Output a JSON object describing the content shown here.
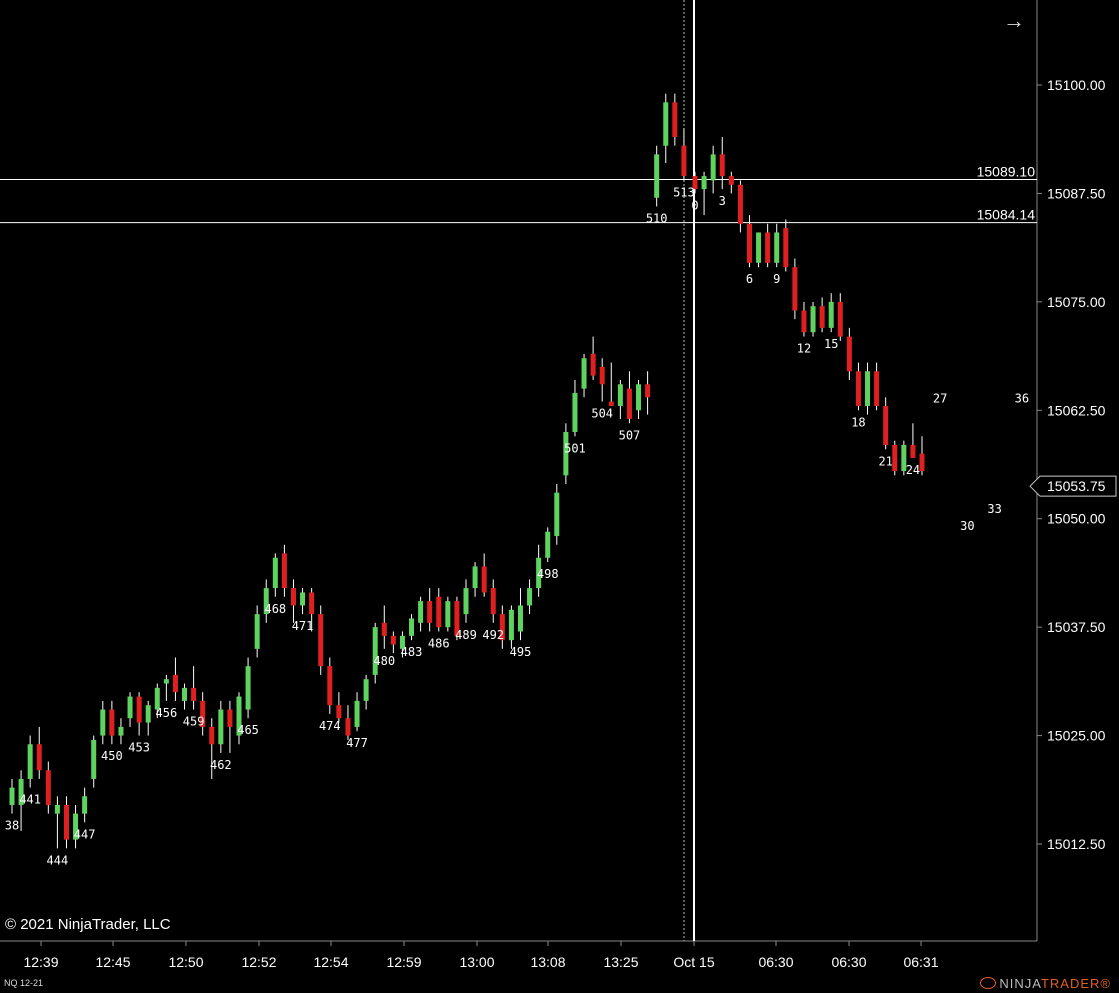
{
  "instrument": "NQ 12-21",
  "copyright": "© 2021 NinjaTrader, LLC",
  "brand": {
    "left": "NINJA",
    "right": "TRADER",
    "mark": "®"
  },
  "nav_arrow": "→",
  "colors": {
    "background": "#000000",
    "up": "#5fd35f",
    "down": "#e02020",
    "wick": "#ffffff",
    "axis_text": "#ffffff"
  },
  "price_axis": {
    "ticks": [
      "15100.00",
      "15087.50",
      "15075.00",
      "15062.50",
      "15050.00",
      "15037.50",
      "15025.00",
      "15012.50"
    ],
    "tick_values": [
      15100,
      15087.5,
      15075,
      15062.5,
      15050,
      15037.5,
      15025,
      15012.5
    ],
    "last_price": "15053.75"
  },
  "time_axis": {
    "labels": [
      "12:39",
      "12:45",
      "12:50",
      "12:52",
      "12:54",
      "12:59",
      "13:00",
      "13:08",
      "13:25",
      "Oct 15",
      "06:30",
      "06:30",
      "06:31"
    ]
  },
  "horizontal_lines": [
    {
      "label": "15089.10",
      "price": 15089.1
    },
    {
      "label": "15084.14",
      "price": 15084.14
    }
  ],
  "chart_data": {
    "type": "candlestick",
    "ylim": [
      15002,
      15110
    ],
    "session_break_index": 38,
    "candles": [
      {
        "o": 15017.0,
        "h": 15020.0,
        "l": 15016.0,
        "c": 15019.0
      },
      {
        "o": 15017.0,
        "h": 15021.0,
        "l": 15014.0,
        "c": 15020.0
      },
      {
        "o": 15020.0,
        "h": 15025.0,
        "l": 15019.0,
        "c": 15024.0
      },
      {
        "o": 15024.0,
        "h": 15026.0,
        "l": 15020.0,
        "c": 15021.0
      },
      {
        "o": 15021.0,
        "h": 15022.0,
        "l": 15016.0,
        "c": 15017.0
      },
      {
        "o": 15016.0,
        "h": 15018.0,
        "l": 15012.0,
        "c": 15017.0
      },
      {
        "o": 15017.0,
        "h": 15018.0,
        "l": 15012.0,
        "c": 15013.0
      },
      {
        "o": 15013.0,
        "h": 15017.0,
        "l": 15012.0,
        "c": 15016.0
      },
      {
        "o": 15016.0,
        "h": 15019.0,
        "l": 15015.0,
        "c": 15018.0
      },
      {
        "o": 15020.0,
        "h": 15025.0,
        "l": 15019.0,
        "c": 15024.5
      },
      {
        "o": 15025.0,
        "h": 15029.0,
        "l": 15024.0,
        "c": 15028.0
      },
      {
        "o": 15028.0,
        "h": 15029.0,
        "l": 15024.0,
        "c": 15025.0
      },
      {
        "o": 15025.0,
        "h": 15027.0,
        "l": 15024.0,
        "c": 15026.0
      },
      {
        "o": 15027.0,
        "h": 15030.0,
        "l": 15026.0,
        "c": 15029.5
      },
      {
        "o": 15029.5,
        "h": 15030.0,
        "l": 15025.0,
        "c": 15026.5
      },
      {
        "o": 15026.5,
        "h": 15029.0,
        "l": 15025.0,
        "c": 15028.5
      },
      {
        "o": 15028.0,
        "h": 15031.0,
        "l": 15027.0,
        "c": 15030.5
      },
      {
        "o": 15031.0,
        "h": 15032.0,
        "l": 15029.0,
        "c": 15031.5
      },
      {
        "o": 15032.0,
        "h": 15034.0,
        "l": 15029.0,
        "c": 15030.0
      },
      {
        "o": 15029.0,
        "h": 15031.0,
        "l": 15028.0,
        "c": 15030.5
      },
      {
        "o": 15030.5,
        "h": 15033.0,
        "l": 15028.0,
        "c": 15029.0
      },
      {
        "o": 15029.0,
        "h": 15030.0,
        "l": 15025.0,
        "c": 15026.0
      },
      {
        "o": 15026.0,
        "h": 15027.0,
        "l": 15020.0,
        "c": 15024.0
      },
      {
        "o": 15024.0,
        "h": 15029.0,
        "l": 15023.0,
        "c": 15028.0
      },
      {
        "o": 15028.0,
        "h": 15029.0,
        "l": 15023.0,
        "c": 15026.0
      },
      {
        "o": 15025.0,
        "h": 15030.0,
        "l": 15024.0,
        "c": 15029.5
      },
      {
        "o": 15028.0,
        "h": 15034.0,
        "l": 15027.0,
        "c": 15033.0
      },
      {
        "o": 15035.0,
        "h": 15040.0,
        "l": 15034.0,
        "c": 15039.0
      },
      {
        "o": 15039.0,
        "h": 15043.0,
        "l": 15038.0,
        "c": 15042.0
      },
      {
        "o": 15042.0,
        "h": 15046.0,
        "l": 15041.0,
        "c": 15045.5
      },
      {
        "o": 15046.0,
        "h": 15047.0,
        "l": 15041.0,
        "c": 15042.0
      },
      {
        "o": 15042.0,
        "h": 15043.0,
        "l": 15038.0,
        "c": 15040.0
      },
      {
        "o": 15040.0,
        "h": 15042.0,
        "l": 15039.0,
        "c": 15041.5
      },
      {
        "o": 15041.5,
        "h": 15042.0,
        "l": 15037.0,
        "c": 15039.0
      },
      {
        "o": 15039.0,
        "h": 15040.0,
        "l": 15032.0,
        "c": 15033.0
      },
      {
        "o": 15033.0,
        "h": 15034.0,
        "l": 15027.5,
        "c": 15028.5
      },
      {
        "o": 15028.5,
        "h": 15030.0,
        "l": 15026.5,
        "c": 15027.0
      },
      {
        "o": 15027.0,
        "h": 15028.5,
        "l": 15024.5,
        "c": 15025.0
      },
      {
        "o": 15026.0,
        "h": 15030.0,
        "l": 15025.5,
        "c": 15029.0
      },
      {
        "o": 15029.0,
        "h": 15032.0,
        "l": 15028.0,
        "c": 15031.5
      },
      {
        "o": 15032.0,
        "h": 15038.0,
        "l": 15031.0,
        "c": 15037.5
      },
      {
        "o": 15038.0,
        "h": 15040.0,
        "l": 15035.0,
        "c": 15036.5
      },
      {
        "o": 15036.5,
        "h": 15037.0,
        "l": 15034.5,
        "c": 15035.5
      },
      {
        "o": 15035.0,
        "h": 15037.0,
        "l": 15034.0,
        "c": 15036.5
      },
      {
        "o": 15036.5,
        "h": 15039.0,
        "l": 15036.0,
        "c": 15038.5
      },
      {
        "o": 15038.0,
        "h": 15041.0,
        "l": 15037.0,
        "c": 15040.5
      },
      {
        "o": 15040.5,
        "h": 15042.0,
        "l": 15037.0,
        "c": 15038.0
      },
      {
        "o": 15041.0,
        "h": 15042.0,
        "l": 15037.0,
        "c": 15037.5
      },
      {
        "o": 15037.5,
        "h": 15041.0,
        "l": 15037.0,
        "c": 15040.5
      },
      {
        "o": 15040.5,
        "h": 15041.0,
        "l": 15036.0,
        "c": 15036.5
      },
      {
        "o": 15039.0,
        "h": 15043.0,
        "l": 15038.0,
        "c": 15042.0
      },
      {
        "o": 15042.0,
        "h": 15045.0,
        "l": 15041.0,
        "c": 15044.5
      },
      {
        "o": 15044.5,
        "h": 15046.0,
        "l": 15041.0,
        "c": 15041.5
      },
      {
        "o": 15042.0,
        "h": 15043.0,
        "l": 15038.0,
        "c": 15039.0
      },
      {
        "o": 15039.0,
        "h": 15040.0,
        "l": 15035.0,
        "c": 15036.0
      },
      {
        "o": 15036.0,
        "h": 15040.0,
        "l": 15035.0,
        "c": 15039.5
      },
      {
        "o": 15037.0,
        "h": 15042.0,
        "l": 15036.0,
        "c": 15040.0
      },
      {
        "o": 15040.0,
        "h": 15043.0,
        "l": 15039.0,
        "c": 15042.0
      },
      {
        "o": 15042.0,
        "h": 15047.0,
        "l": 15041.0,
        "c": 15045.5
      },
      {
        "o": 15045.5,
        "h": 15049.0,
        "l": 15045.0,
        "c": 15048.5
      },
      {
        "o": 15048.0,
        "h": 15054.0,
        "l": 15047.0,
        "c": 15053.0
      },
      {
        "o": 15055.0,
        "h": 15061.0,
        "l": 15054.0,
        "c": 15060.0
      },
      {
        "o": 15060.0,
        "h": 15066.0,
        "l": 15059.5,
        "c": 15064.5
      },
      {
        "o": 15065.0,
        "h": 15069.0,
        "l": 15064.0,
        "c": 15068.5
      },
      {
        "o": 15069.0,
        "h": 15071.0,
        "l": 15066.0,
        "c": 15066.5
      },
      {
        "o": 15067.5,
        "h": 15068.5,
        "l": 15063.5,
        "c": 15065.5
      },
      {
        "o": 15063.5,
        "h": 15068.0,
        "l": 15063.0,
        "c": 15063.0
      },
      {
        "o": 15063.0,
        "h": 15066.0,
        "l": 15061.5,
        "c": 15065.5
      },
      {
        "o": 15065.0,
        "h": 15067.0,
        "l": 15061.0,
        "c": 15061.5
      },
      {
        "o": 15062.5,
        "h": 15066.0,
        "l": 15061.5,
        "c": 15065.5
      },
      {
        "o": 15065.5,
        "h": 15067.0,
        "l": 15062.0,
        "c": 15064.0
      },
      {
        "o": 15087.0,
        "h": 15093.0,
        "l": 15086.0,
        "c": 15092.0
      },
      {
        "o": 15093.0,
        "h": 15099.0,
        "l": 15091.0,
        "c": 15098.0
      },
      {
        "o": 15098.0,
        "h": 15099.0,
        "l": 15093.0,
        "c": 15094.0
      },
      {
        "o": 15093.0,
        "h": 15095.0,
        "l": 15089.0,
        "c": 15089.5
      },
      {
        "o": 15089.5,
        "h": 15090.0,
        "l": 15087.5,
        "c": 15088.0
      },
      {
        "o": 15088.0,
        "h": 15090.0,
        "l": 15085.0,
        "c": 15089.5
      },
      {
        "o": 15089.0,
        "h": 15093.0,
        "l": 15087.5,
        "c": 15092.0
      },
      {
        "o": 15092.0,
        "h": 15094.0,
        "l": 15088.0,
        "c": 15089.5
      },
      {
        "o": 15089.5,
        "h": 15090.0,
        "l": 15087.5,
        "c": 15088.5
      },
      {
        "o": 15088.5,
        "h": 15089.0,
        "l": 15083.0,
        "c": 15084.0
      },
      {
        "o": 15084.0,
        "h": 15085.0,
        "l": 15079.0,
        "c": 15079.5
      },
      {
        "o": 15079.5,
        "h": 15083.0,
        "l": 15079.0,
        "c": 15083.0
      },
      {
        "o": 15083.0,
        "h": 15084.0,
        "l": 15079.0,
        "c": 15079.5
      },
      {
        "o": 15079.5,
        "h": 15084.0,
        "l": 15079.0,
        "c": 15083.0
      },
      {
        "o": 15083.5,
        "h": 15084.5,
        "l": 15078.5,
        "c": 15079.0
      },
      {
        "o": 15079.0,
        "h": 15080.0,
        "l": 15073.0,
        "c": 15074.0
      },
      {
        "o": 15074.0,
        "h": 15075.0,
        "l": 15071.0,
        "c": 15071.5
      },
      {
        "o": 15071.5,
        "h": 15075.0,
        "l": 15071.0,
        "c": 15074.5
      },
      {
        "o": 15074.5,
        "h": 15075.5,
        "l": 15071.5,
        "c": 15072.0
      },
      {
        "o": 15072.0,
        "h": 15076.0,
        "l": 15071.5,
        "c": 15075.0
      },
      {
        "o": 15075.0,
        "h": 15076.0,
        "l": 15070.5,
        "c": 15071.0
      },
      {
        "o": 15071.0,
        "h": 15072.0,
        "l": 15066.0,
        "c": 15067.0
      },
      {
        "o": 15067.0,
        "h": 15068.0,
        "l": 15062.5,
        "c": 15063.0
      },
      {
        "o": 15063.0,
        "h": 15068.0,
        "l": 15062.0,
        "c": 15067.0
      },
      {
        "o": 15067.0,
        "h": 15068.0,
        "l": 15062.5,
        "c": 15063.0
      },
      {
        "o": 15063.0,
        "h": 15064.0,
        "l": 15058.0,
        "c": 15058.5
      },
      {
        "o": 15058.5,
        "h": 15059.0,
        "l": 15055.0,
        "c": 15055.5
      },
      {
        "o": 15055.5,
        "h": 15059.0,
        "l": 15055.0,
        "c": 15058.5
      },
      {
        "o": 15058.5,
        "h": 15061.0,
        "l": 15057.0,
        "c": 15057.0
      },
      {
        "o": 15057.5,
        "h": 15059.5,
        "l": 15055.0,
        "c": 15055.5
      }
    ],
    "bar_labels": [
      {
        "i": 0,
        "text": "38",
        "pos": "low"
      },
      {
        "i": 2,
        "text": "441",
        "pos": "low"
      },
      {
        "i": 5,
        "text": "444",
        "pos": "low"
      },
      {
        "i": 8,
        "text": "447",
        "pos": "low"
      },
      {
        "i": 11,
        "text": "450",
        "pos": "low"
      },
      {
        "i": 14,
        "text": "453",
        "pos": "low"
      },
      {
        "i": 17,
        "text": "456",
        "pos": "low"
      },
      {
        "i": 20,
        "text": "459",
        "pos": "low"
      },
      {
        "i": 23,
        "text": "462",
        "pos": "low"
      },
      {
        "i": 26,
        "text": "465",
        "pos": "low"
      },
      {
        "i": 29,
        "text": "468",
        "pos": "low"
      },
      {
        "i": 32,
        "text": "471",
        "pos": "low"
      },
      {
        "i": 35,
        "text": "474",
        "pos": "low"
      },
      {
        "i": 38,
        "text": "477",
        "pos": "low"
      },
      {
        "i": 41,
        "text": "480",
        "pos": "low"
      },
      {
        "i": 44,
        "text": "483",
        "pos": "low"
      },
      {
        "i": 47,
        "text": "486",
        "pos": "low"
      },
      {
        "i": 50,
        "text": "489",
        "pos": "low"
      },
      {
        "i": 53,
        "text": "492",
        "pos": "low"
      },
      {
        "i": 56,
        "text": "495",
        "pos": "low"
      },
      {
        "i": 59,
        "text": "498",
        "pos": "low"
      },
      {
        "i": 62,
        "text": "501",
        "pos": "low"
      },
      {
        "i": 65,
        "text": "504",
        "pos": "low"
      },
      {
        "i": 68,
        "text": "507",
        "pos": "low"
      },
      {
        "i": 71,
        "text": "510",
        "pos": "low"
      },
      {
        "i": 74,
        "text": "513",
        "pos": "low"
      },
      {
        "i": 75,
        "text": "0",
        "pos": "low"
      },
      {
        "i": 78,
        "text": "3",
        "pos": "low"
      },
      {
        "i": 81,
        "text": "6",
        "pos": "low"
      },
      {
        "i": 84,
        "text": "9",
        "pos": "low"
      },
      {
        "i": 87,
        "text": "12",
        "pos": "low"
      },
      {
        "i": 90,
        "text": "15",
        "pos": "low"
      },
      {
        "i": 93,
        "text": "18",
        "pos": "low"
      },
      {
        "i": 96,
        "text": "21",
        "pos": "low"
      },
      {
        "i": 99,
        "text": "24",
        "pos": "low"
      },
      {
        "i": 102,
        "text": "27",
        "pos": "low"
      },
      {
        "i": 105,
        "text": "30",
        "pos": "low"
      },
      {
        "i": 108,
        "text": "33",
        "pos": "low"
      },
      {
        "i": 111,
        "text": "36",
        "pos": "low"
      }
    ]
  }
}
